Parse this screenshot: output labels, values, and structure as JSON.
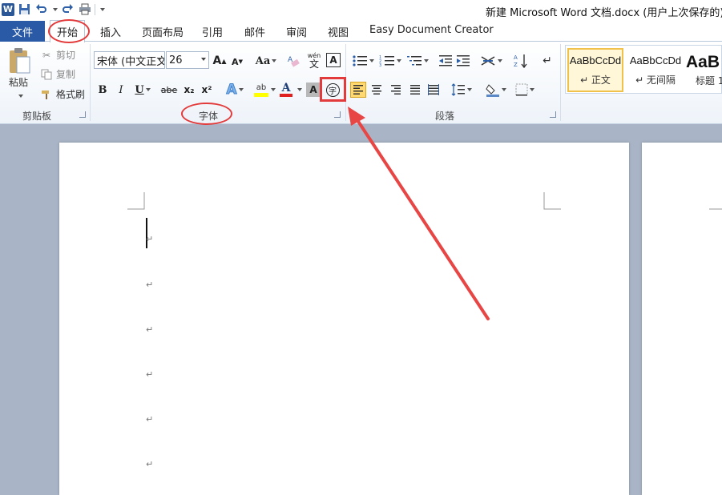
{
  "window": {
    "title": "新建 Microsoft Word 文档.docx (用户上次保存的) - ",
    "app_logo": "W"
  },
  "quick_access": {
    "icons": [
      "word-logo-icon",
      "save-icon",
      "undo-icon",
      "redo-icon",
      "print-icon",
      "customize-qat-icon"
    ]
  },
  "tabs": {
    "file": "文件",
    "items": [
      "开始",
      "插入",
      "页面布局",
      "引用",
      "邮件",
      "审阅",
      "视图",
      "Easy Document Creator"
    ],
    "active": "开始"
  },
  "clipboard": {
    "paste": "粘贴",
    "cut": "剪切",
    "copy": "复制",
    "format_painter": "格式刷",
    "group_label": "剪贴板"
  },
  "font": {
    "font_name": "宋体 (中文正文",
    "font_size": "26",
    "grow": "A",
    "shrink": "A",
    "change_case": "Aa",
    "pinyin": "wén",
    "border_char": "A",
    "bold": "B",
    "italic": "I",
    "underline": "U",
    "strike": "abe",
    "subscript": "x₂",
    "superscript": "x²",
    "text_effect": "A",
    "highlight": "ab",
    "font_color": "A",
    "char_shading": "A",
    "enclose_char": "字",
    "group_label": "字体"
  },
  "paragraph": {
    "group_label": "段落"
  },
  "styles": {
    "items": [
      {
        "sample": "AaBbCcDd",
        "name": "↵ 正文"
      },
      {
        "sample": "AaBbCcDd",
        "name": "↵ 无间隔"
      },
      {
        "sample": "AaB",
        "name": "标题 1"
      }
    ]
  },
  "document": {
    "paragraph_mark": "↵"
  },
  "colors": {
    "file_tab": "#2a5aa6",
    "annotation": "#e33b3b",
    "highlight_yellow": "#ffff00",
    "font_red": "#e02020"
  }
}
